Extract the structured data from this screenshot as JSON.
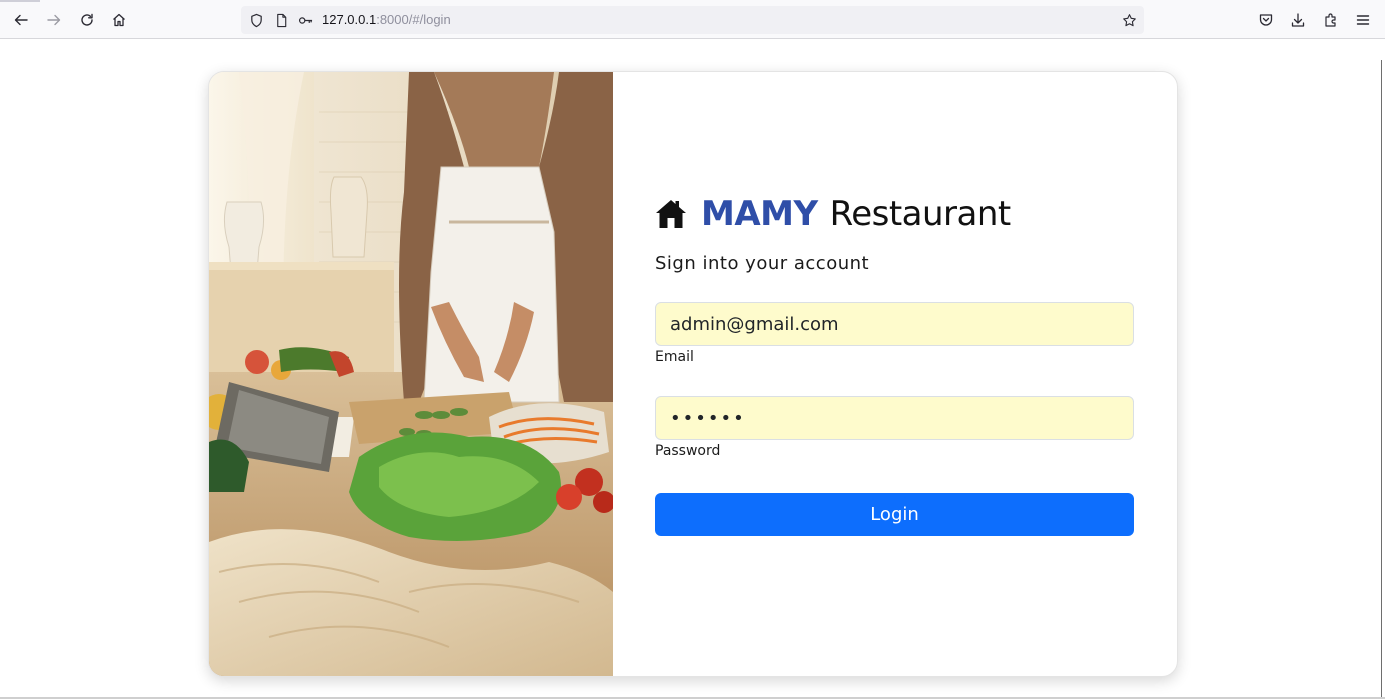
{
  "browser": {
    "url_host": "127.0.0.1",
    "url_rest": ":8000/#/login",
    "icons": [
      "back-icon",
      "forward-icon",
      "reload-icon",
      "home-icon",
      "shield-icon",
      "page-icon",
      "key-icon",
      "bookmark-star-icon",
      "pocket-icon",
      "download-icon",
      "extensions-icon",
      "menu-icon"
    ]
  },
  "login": {
    "brand_strong": "MAMY",
    "brand_rest": "Restaurant",
    "subtitle": "Sign into your account",
    "email_value": "admin@gmail.com",
    "email_label": "Email",
    "password_value": "••••••",
    "password_label": "Password",
    "submit_label": "Login"
  },
  "colors": {
    "brand": "#2f4ea8",
    "button": "#0d6efd",
    "autofill": "#fefbcc"
  }
}
